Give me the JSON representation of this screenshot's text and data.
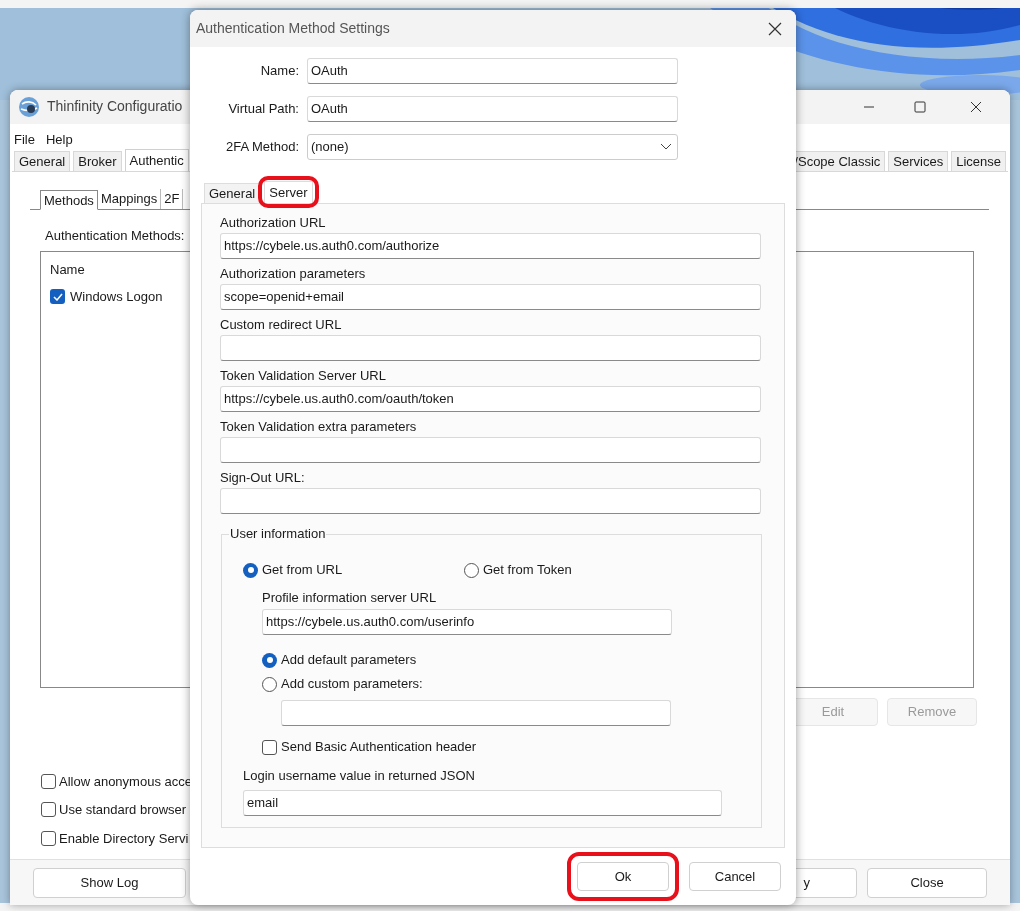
{
  "main_window": {
    "title": "Thinfinity Configuratio",
    "menu": [
      "File",
      "Help"
    ],
    "tabs_left": [
      {
        "label": "General",
        "selected": false
      },
      {
        "label": "Broker",
        "selected": false
      },
      {
        "label": "Authentic",
        "selected": true
      }
    ],
    "tabs_right": [
      {
        "label": "/Scope Classic",
        "selected": false
      },
      {
        "label": "Services",
        "selected": false
      },
      {
        "label": "License",
        "selected": false
      }
    ],
    "subtabs": [
      {
        "label": "Methods",
        "selected": true
      },
      {
        "label": "Mappings",
        "selected": false
      },
      {
        "label": "2F",
        "selected": false
      }
    ],
    "list_label": "Authentication Methods:",
    "list": {
      "column": "Name",
      "rows": [
        {
          "label": "Windows Logon",
          "checked": true
        }
      ]
    },
    "list_buttons": [
      {
        "label": "Edit",
        "disabled": true
      },
      {
        "label": "Remove",
        "disabled": true
      }
    ],
    "options": [
      {
        "label": "Allow anonymous acce",
        "checked": false
      },
      {
        "label": "Use standard browser",
        "checked": false
      },
      {
        "label": "Enable Directory Servi",
        "checked": false
      }
    ],
    "footer_buttons_left": [
      "Show Log"
    ],
    "footer_buttons_right": [
      "y",
      "Close"
    ]
  },
  "dialog": {
    "title": "Authentication Method Settings",
    "top_fields": [
      {
        "label": "Name:",
        "value": "OAuth",
        "kind": "text"
      },
      {
        "label": "Virtual Path:",
        "value": "OAuth",
        "kind": "text"
      },
      {
        "label": "2FA Method:",
        "value": "(none)",
        "kind": "dropdown"
      }
    ],
    "tabs": [
      {
        "label": "General",
        "selected": false,
        "highlighted": false
      },
      {
        "label": "Server",
        "selected": true,
        "highlighted": true
      }
    ],
    "server_fields": [
      {
        "label": "Authorization URL",
        "value": "https://cybele.us.auth0.com/authorize"
      },
      {
        "label": "Authorization parameters",
        "value": "scope=openid+email"
      },
      {
        "label": "Custom redirect URL"
      },
      {
        "label": "Token Validation Server URL",
        "value": "https://cybele.us.auth0.com/oauth/token"
      },
      {
        "label": "Token Validation extra parameters"
      },
      {
        "label": "Sign-Out URL:"
      }
    ],
    "user_info": {
      "title": "User information",
      "sources": [
        {
          "label": "Get from URL",
          "selected": true
        },
        {
          "label": "Get from Token",
          "selected": false
        }
      ],
      "profile_url_label": "Profile information server URL",
      "profile_url": "https://cybele.us.auth0.com/userinfo",
      "params": [
        {
          "label": "Add default parameters",
          "selected": true
        },
        {
          "label": "Add custom parameters:",
          "selected": false
        }
      ],
      "send_basic_auth": {
        "label": "Send Basic Authentication header",
        "checked": false
      },
      "login_label": "Login username value in returned JSON",
      "login_value": "email"
    },
    "buttons": [
      {
        "label": "Ok",
        "highlighted": true
      },
      {
        "label": "Cancel",
        "highlighted": false
      }
    ]
  }
}
